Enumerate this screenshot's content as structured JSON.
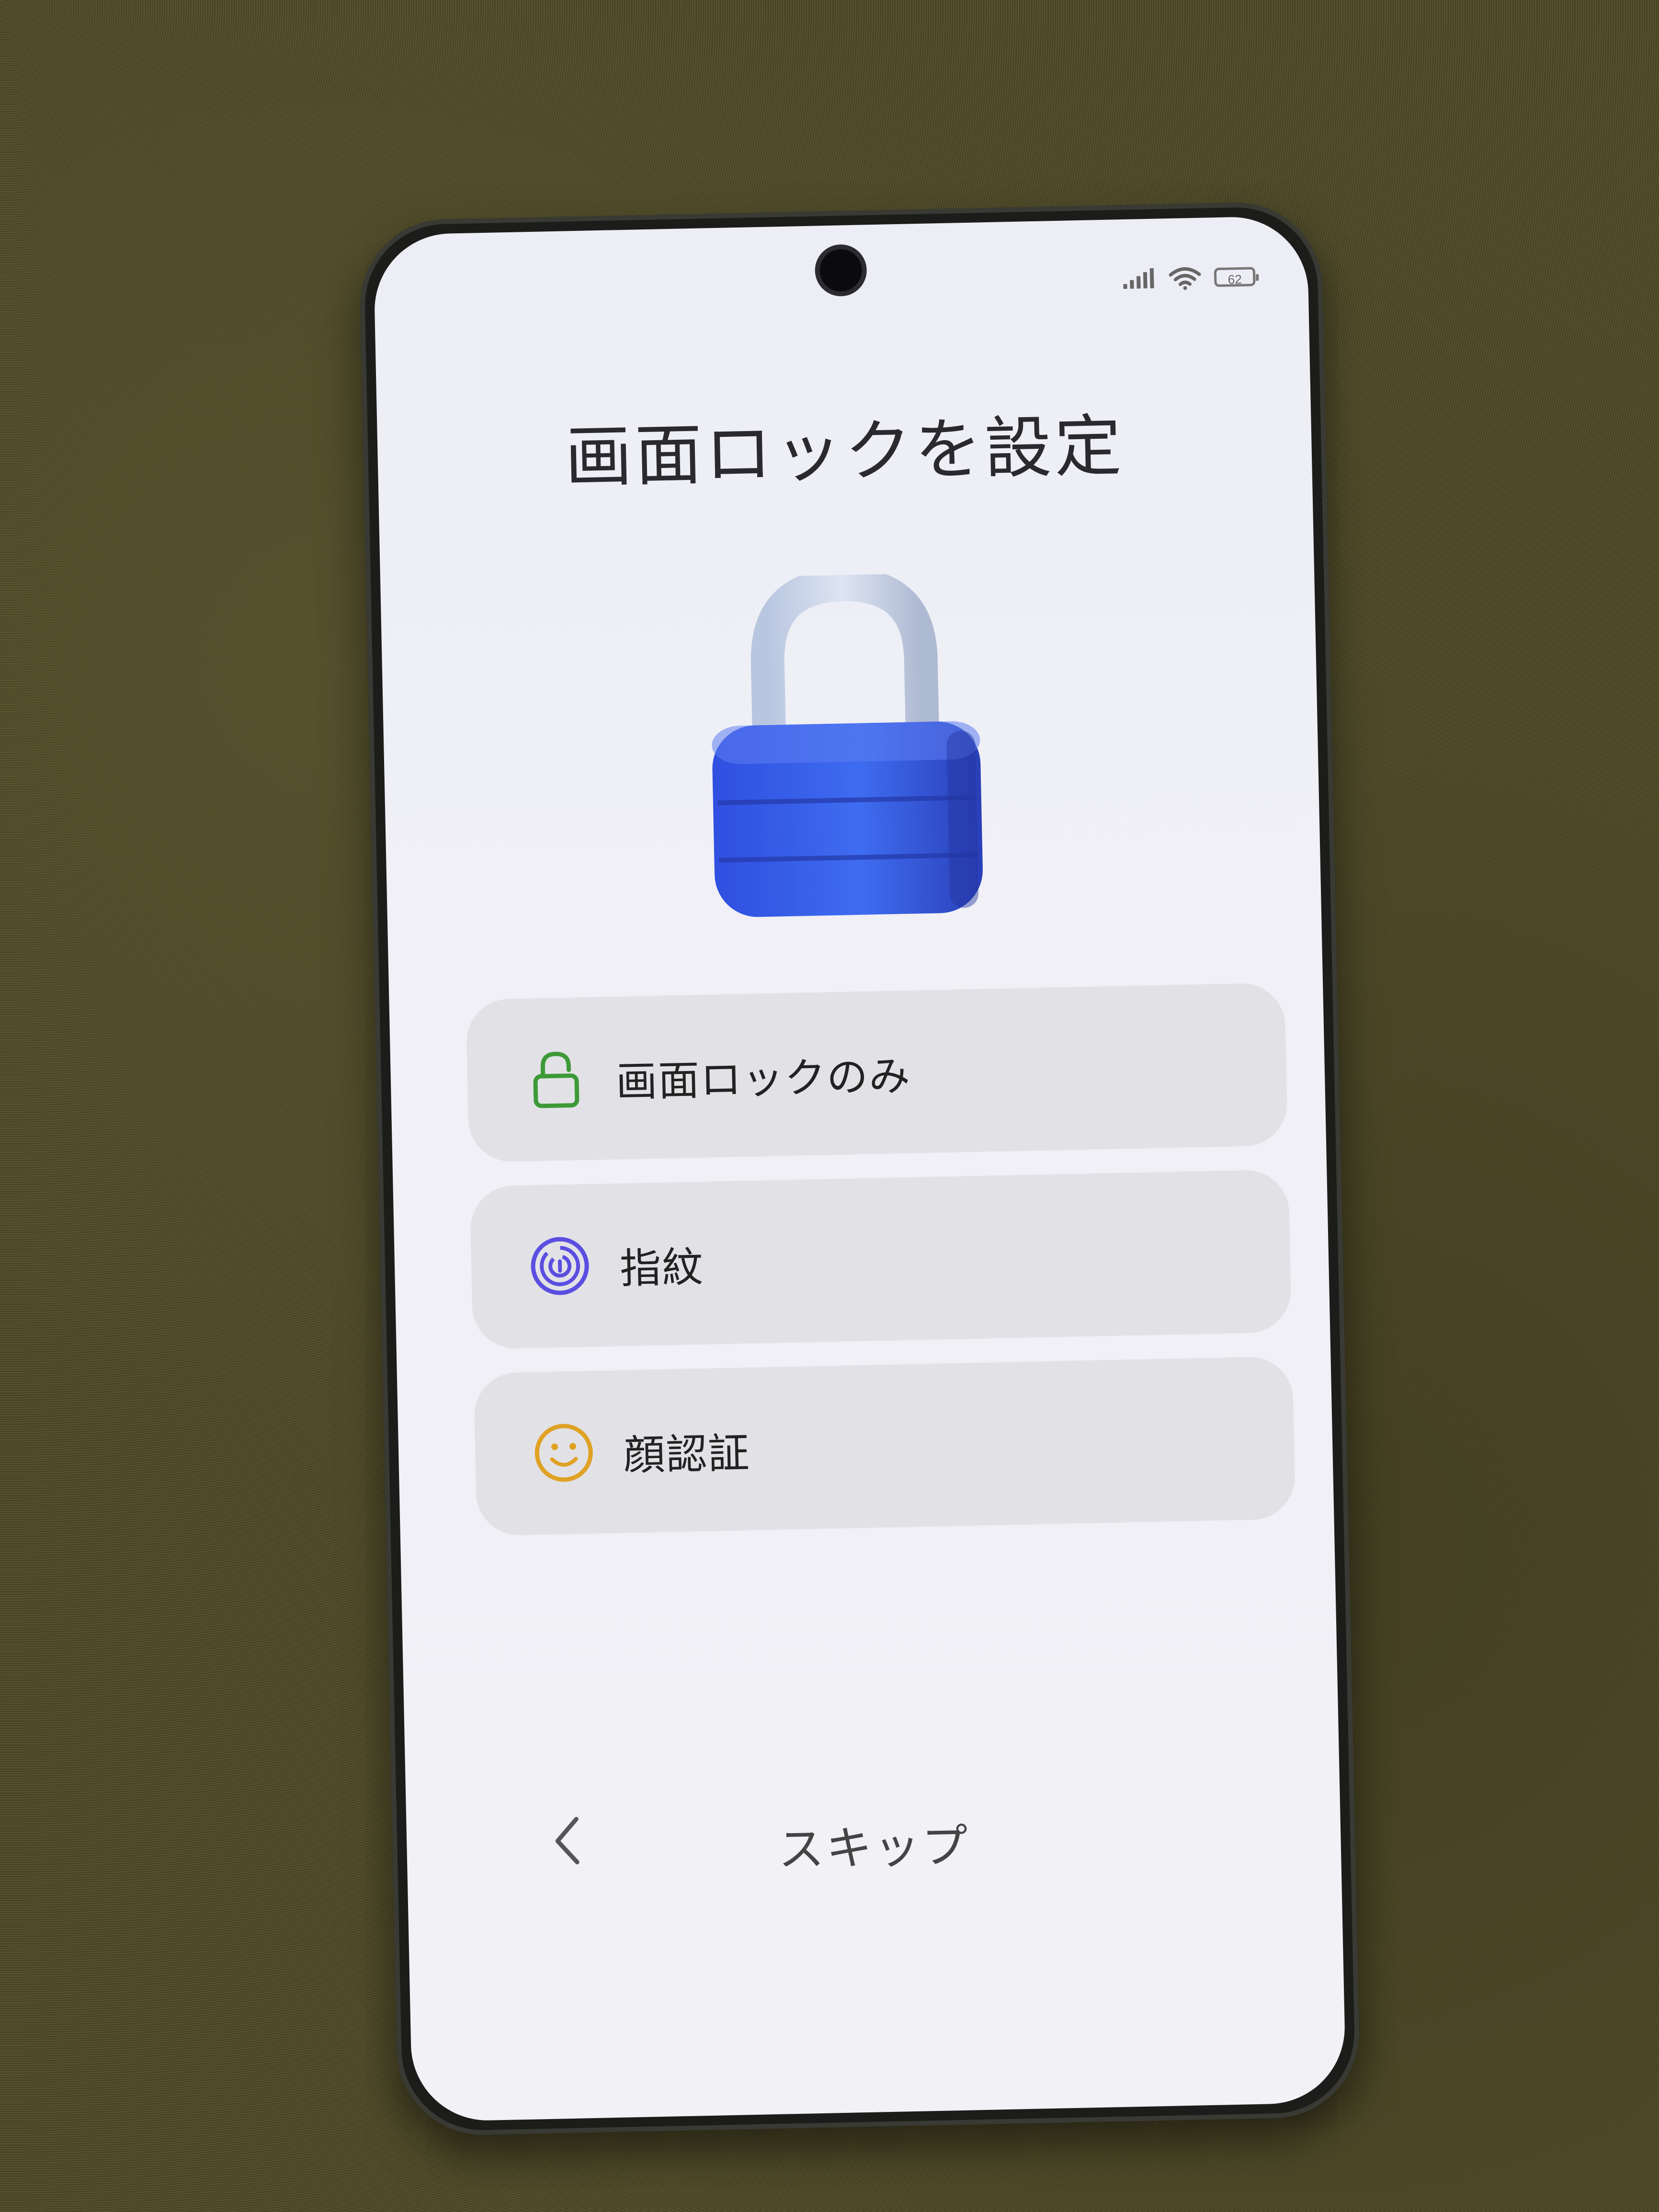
{
  "status_bar": {
    "battery": "62",
    "icons": [
      "signal-icon",
      "wifi-icon",
      "battery-icon"
    ]
  },
  "header": {
    "title": "画面ロックを設定"
  },
  "illustration": {
    "icon": "padlock-icon",
    "colors": {
      "body": "#3b63e6",
      "shackle": "#c9d3e6"
    }
  },
  "options": [
    {
      "label": "画面ロックのみ",
      "icon": "lock-icon",
      "color": "#3d9a37"
    },
    {
      "label": "指紋",
      "icon": "fingerprint-icon",
      "color": "#5b4ee0"
    },
    {
      "label": "顔認証",
      "icon": "smiley-face-icon",
      "color": "#e0a224"
    }
  ],
  "footer": {
    "back_icon": "chevron-left-icon",
    "skip_label": "スキップ"
  }
}
